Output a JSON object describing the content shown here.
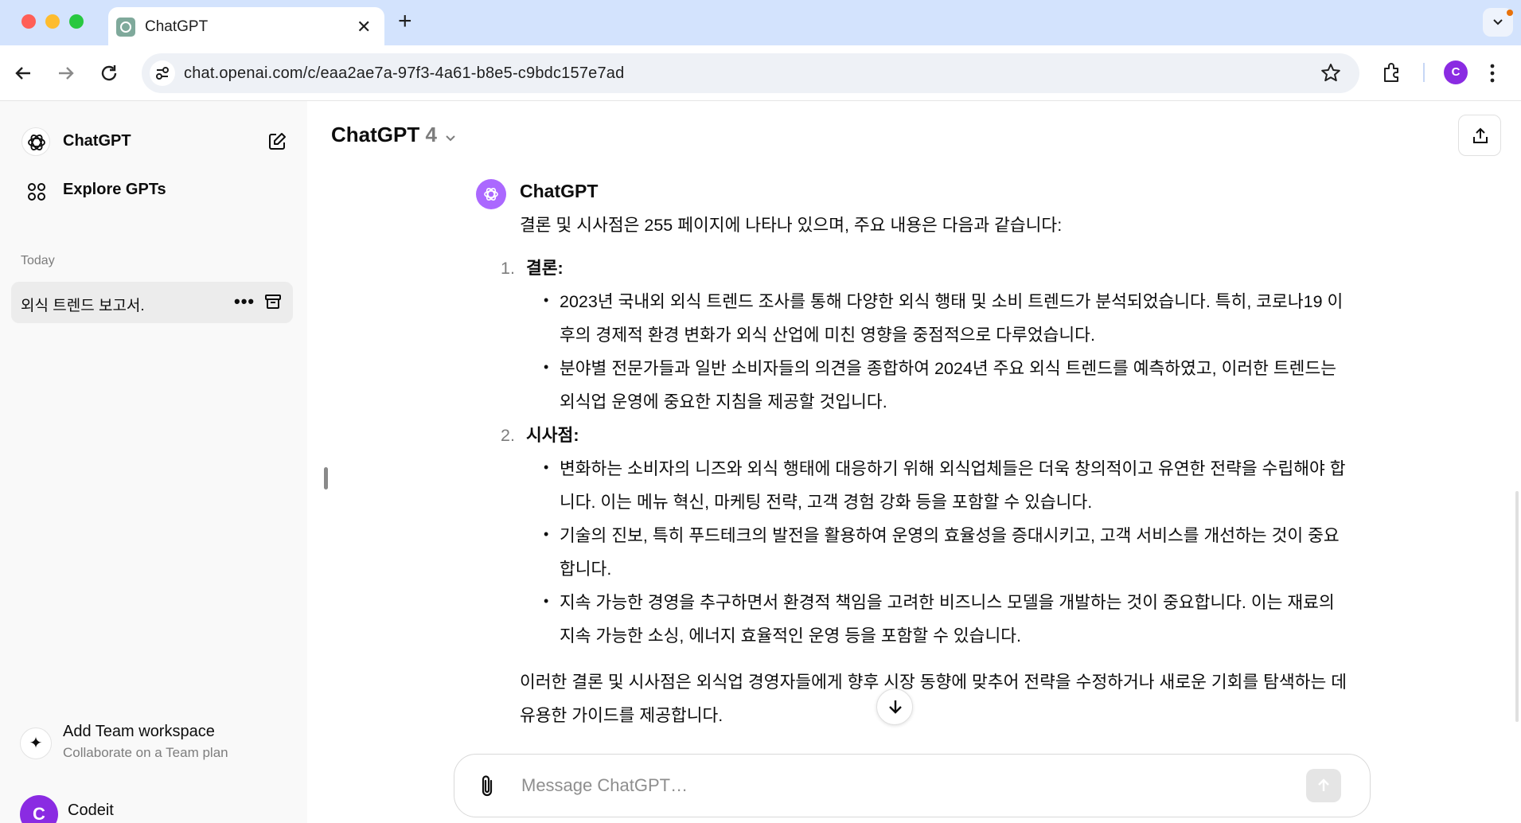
{
  "browser": {
    "tab": {
      "title": "ChatGPT",
      "close": "✕"
    },
    "new_tab": "+",
    "url": "chat.openai.com/c/eaa2ae7a-97f3-4a61-b8e5-c9bdc157e7ad",
    "profile_initial": "C",
    "icons": [
      "back-icon",
      "forward-icon",
      "reload-icon",
      "site-settings-icon",
      "star-icon",
      "extensions-icon",
      "menu-icon"
    ]
  },
  "sidebar": {
    "app_title": "ChatGPT",
    "explore": "Explore GPTs",
    "section_label": "Today",
    "history": [
      {
        "title": "외식 트렌드 보고서."
      }
    ],
    "history_more": "•••",
    "team": {
      "title": "Add Team workspace",
      "subtitle": "Collaborate on a Team plan",
      "icon": "✦"
    },
    "user": {
      "name": "Codeit",
      "initial": "C"
    }
  },
  "main": {
    "model": {
      "name": "ChatGPT",
      "version": "4"
    },
    "message": {
      "author": "ChatGPT",
      "intro": "결론 및 시사점은 255 페이지에 나타나 있으며, 주요 내용은 다음과 같습니다:",
      "sections": [
        {
          "number": "1.",
          "heading": "결론:",
          "bullets": [
            "2023년 국내외 외식 트렌드 조사를 통해 다양한 외식 행태 및 소비 트렌드가 분석되었습니다. 특히, 코로나19 이후의 경제적 환경 변화가 외식 산업에 미친 영향을 중점적으로 다루었습니다.",
            "분야별 전문가들과 일반 소비자들의 의견을 종합하여 2024년 주요 외식 트렌드를 예측하였고, 이러한 트렌드는 외식업 운영에 중요한 지침을 제공할 것입니다."
          ]
        },
        {
          "number": "2.",
          "heading": "시사점:",
          "bullets": [
            "변화하는 소비자의 니즈와 외식 행태에 대응하기 위해 외식업체들은 더욱 창의적이고 유연한 전략을 수립해야 합니다. 이는 메뉴 혁신, 마케팅 전략, 고객 경험 강화 등을 포함할 수 있습니다.",
            "기술의 진보, 특히 푸드테크의 발전을 활용하여 운영의 효율성을 증대시키고, 고객 서비스를 개선하는 것이 중요합니다.",
            "지속 가능한 경영을 추구하면서 환경적 책임을 고려한 비즈니스 모델을 개발하는 것이 중요합니다. 이는 재료의 지속 가능한 소싱, 에너지 효율적인 운영 등을 포함할 수 있습니다."
          ]
        }
      ],
      "outro": "이러한 결론 및 시사점은 외식업 경영자들에게 향후 시장 동향에 맞추어 전략을 수정하거나 새로운 기회를 탐색하는 데 유용한 가이드를 제공합니다."
    },
    "composer": {
      "placeholder": "Message ChatGPT…"
    }
  },
  "colors": {
    "tabbar": "#d3e3fd",
    "sidebar": "#f9f9f9",
    "accent_purple": "#8a2be2",
    "chatgpt_avatar": "#ab68ff"
  }
}
